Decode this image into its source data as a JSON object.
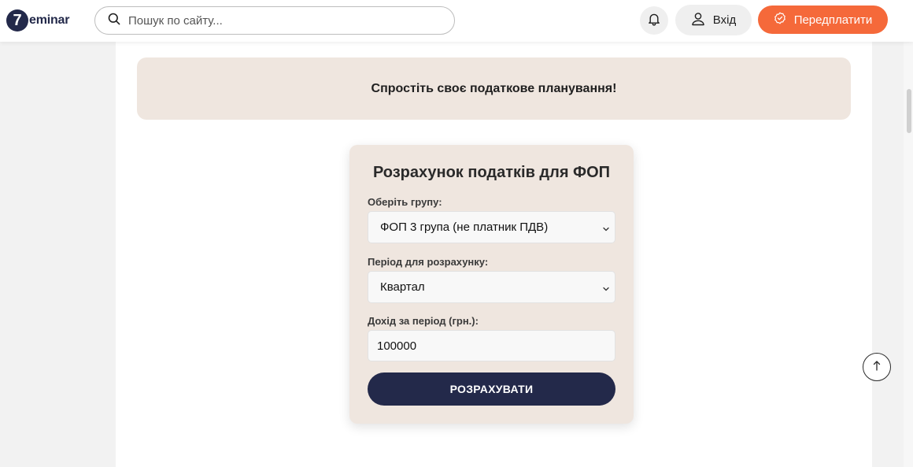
{
  "header": {
    "logo_mark": "7",
    "logo_text": "eminar",
    "search_placeholder": "Пошук по сайту...",
    "login_label": "Вхід",
    "subscribe_label": "Передплатити"
  },
  "promo": {
    "text": "Спростіть своє податкове планування!"
  },
  "calculator": {
    "title": "Розрахунок податків для ФОП",
    "group_label": "Оберіть групу:",
    "group_value": "ФОП 3 група (не платник ПДВ)",
    "period_label": "Період для розрахунку:",
    "period_value": "Квартал",
    "income_label": "Дохід за період (грн.):",
    "income_value": "100000",
    "submit_label": "РОЗРАХУВАТИ"
  },
  "colors": {
    "brand_navy": "#23294a",
    "accent_orange": "#f5693a",
    "card_beige": "#efe6df"
  },
  "icons": {
    "search": "search-icon",
    "bell": "bell-icon",
    "user": "user-icon",
    "badge": "badge-check-icon",
    "chevron": "chevron-down-icon",
    "arrow_up": "arrow-up-icon"
  }
}
